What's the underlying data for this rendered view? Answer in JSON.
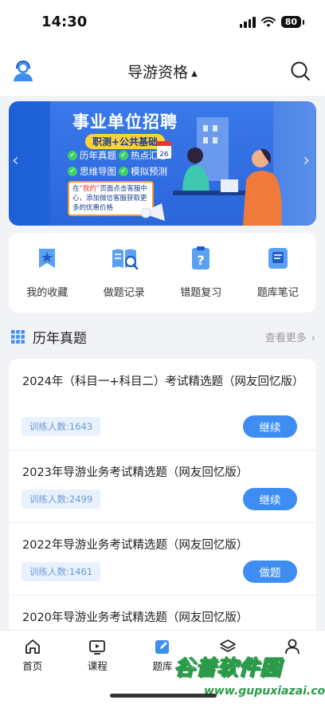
{
  "status_bar": {
    "time": "14:30",
    "battery": "80"
  },
  "header": {
    "title": "导游资格",
    "dropdown_glyph": "▲"
  },
  "banner": {
    "title": "事业单位招聘",
    "tag": "职测+公共基础",
    "features": [
      "历年真题",
      "热点汇总",
      "思维导图",
      "模拟预测"
    ],
    "note_prefix": "在",
    "note_highlight": "“我的”",
    "note_text": "页面点击客服中心，添加微信客服获取更多的优惠价格",
    "calendar_day": "26"
  },
  "quick_actions": [
    {
      "label": "我的收藏",
      "icon": "favorites-icon"
    },
    {
      "label": "做题记录",
      "icon": "record-book-icon"
    },
    {
      "label": "错题复习",
      "icon": "question-clipboard-icon"
    },
    {
      "label": "题库笔记",
      "icon": "note-icon"
    }
  ],
  "section": {
    "title": "历年真题",
    "more": "查看更多"
  },
  "exams": [
    {
      "title": "2024年（科目一+科目二）考试精选题（网友回忆版）",
      "count": "训练人数:1643",
      "action": "继续"
    },
    {
      "title": "2023年导游业务考试精选题（网友回忆版）",
      "count": "训练人数:2499",
      "action": "继续"
    },
    {
      "title": "2022年导游业务考试精选题（网友回忆版）",
      "count": "训练人数:1461",
      "action": "做题"
    },
    {
      "title": "2020年导游业务考试精选题（网友回忆版）"
    }
  ],
  "tabs": [
    {
      "label": "首页",
      "icon": "home-icon"
    },
    {
      "label": "课程",
      "icon": "play-icon"
    },
    {
      "label": "题库",
      "icon": "edit-icon",
      "active": true
    },
    {
      "label": "",
      "icon": "layers-icon"
    },
    {
      "label": "",
      "icon": "person-icon"
    }
  ],
  "watermark": {
    "main": "谷普软件园",
    "sub": "www.gupuxiazai.com"
  },
  "colors": {
    "accent": "#3d8df3",
    "banner": "#2a6fe6",
    "count_bg": "#e8f1fd",
    "watermark": "#2b9a49"
  }
}
